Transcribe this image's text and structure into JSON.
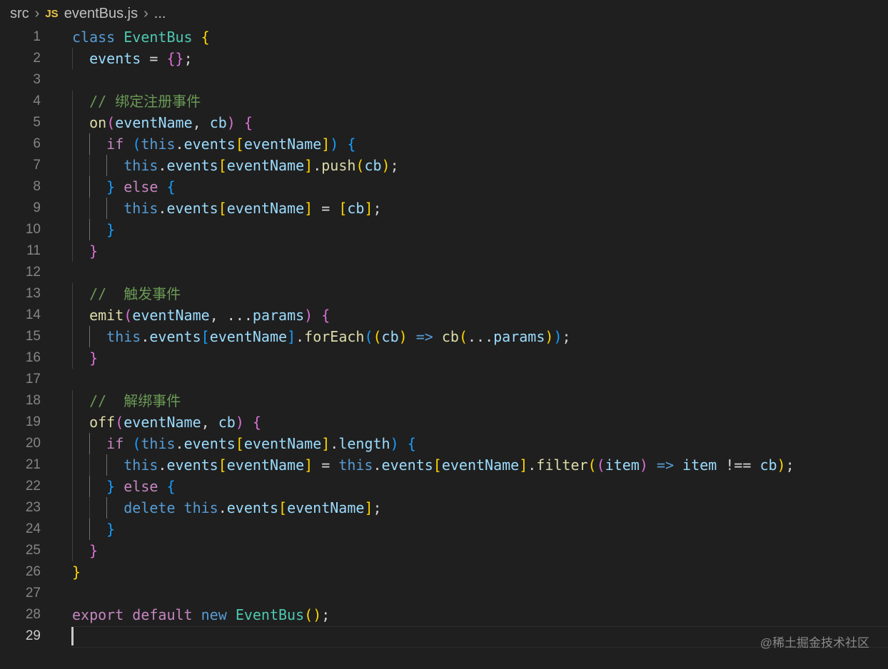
{
  "breadcrumb": {
    "folder": "src",
    "badge": "JS",
    "file": "eventBus.js",
    "more": "...",
    "sep_icon": "chevron-right-icon"
  },
  "colors": {
    "keyword": "#569cd6",
    "control": "#c586c0",
    "class": "#4ec9b0",
    "func": "#dcdcaa",
    "var": "#9cdcfe",
    "comment": "#6a9955",
    "text": "#d4d4d4",
    "brace1": "#ffd700",
    "brace2": "#da70d6",
    "brace3": "#179fff"
  },
  "lines": [
    {
      "n": "1",
      "indent": 0,
      "tokens": [
        [
          "class",
          "keyword"
        ],
        [
          " ",
          ""
        ],
        [
          "EventBus",
          "class"
        ],
        [
          " ",
          ""
        ],
        [
          "{",
          "brace1"
        ]
      ]
    },
    {
      "n": "2",
      "indent": 1,
      "tokens": [
        [
          "events",
          "var"
        ],
        [
          " = ",
          ""
        ],
        [
          "{}",
          "brace2"
        ],
        [
          ";",
          ""
        ]
      ]
    },
    {
      "n": "3",
      "indent": 0,
      "tokens": []
    },
    {
      "n": "4",
      "indent": 1,
      "tokens": [
        [
          "// 绑定注册事件",
          "comment"
        ]
      ]
    },
    {
      "n": "5",
      "indent": 1,
      "tokens": [
        [
          "on",
          "func"
        ],
        [
          "(",
          "brace2"
        ],
        [
          "eventName",
          "var"
        ],
        [
          ", ",
          ""
        ],
        [
          "cb",
          "var"
        ],
        [
          ")",
          "brace2"
        ],
        [
          " ",
          ""
        ],
        [
          "{",
          "brace2"
        ]
      ]
    },
    {
      "n": "6",
      "indent": 2,
      "tokens": [
        [
          "if",
          "control"
        ],
        [
          " ",
          ""
        ],
        [
          "(",
          "brace3"
        ],
        [
          "this",
          "keyword"
        ],
        [
          ".",
          ""
        ],
        [
          "events",
          "var"
        ],
        [
          "[",
          "brace1"
        ],
        [
          "eventName",
          "var"
        ],
        [
          "]",
          "brace1"
        ],
        [
          ")",
          "brace3"
        ],
        [
          " ",
          ""
        ],
        [
          "{",
          "brace3"
        ]
      ]
    },
    {
      "n": "7",
      "indent": 3,
      "tokens": [
        [
          "this",
          "keyword"
        ],
        [
          ".",
          ""
        ],
        [
          "events",
          "var"
        ],
        [
          "[",
          "brace1"
        ],
        [
          "eventName",
          "var"
        ],
        [
          "]",
          "brace1"
        ],
        [
          ".",
          ""
        ],
        [
          "push",
          "func"
        ],
        [
          "(",
          "brace1"
        ],
        [
          "cb",
          "var"
        ],
        [
          ")",
          "brace1"
        ],
        [
          ";",
          ""
        ]
      ]
    },
    {
      "n": "8",
      "indent": 2,
      "tokens": [
        [
          "}",
          "brace3"
        ],
        [
          " ",
          ""
        ],
        [
          "else",
          "control"
        ],
        [
          " ",
          ""
        ],
        [
          "{",
          "brace3"
        ]
      ]
    },
    {
      "n": "9",
      "indent": 3,
      "tokens": [
        [
          "this",
          "keyword"
        ],
        [
          ".",
          ""
        ],
        [
          "events",
          "var"
        ],
        [
          "[",
          "brace1"
        ],
        [
          "eventName",
          "var"
        ],
        [
          "]",
          "brace1"
        ],
        [
          " = ",
          ""
        ],
        [
          "[",
          "brace1"
        ],
        [
          "cb",
          "var"
        ],
        [
          "]",
          "brace1"
        ],
        [
          ";",
          ""
        ]
      ]
    },
    {
      "n": "10",
      "indent": 2,
      "tokens": [
        [
          "}",
          "brace3"
        ]
      ]
    },
    {
      "n": "11",
      "indent": 1,
      "tokens": [
        [
          "}",
          "brace2"
        ]
      ]
    },
    {
      "n": "12",
      "indent": 0,
      "tokens": []
    },
    {
      "n": "13",
      "indent": 1,
      "tokens": [
        [
          "//  触发事件",
          "comment"
        ]
      ]
    },
    {
      "n": "14",
      "indent": 1,
      "tokens": [
        [
          "emit",
          "func"
        ],
        [
          "(",
          "brace2"
        ],
        [
          "eventName",
          "var"
        ],
        [
          ", ",
          ""
        ],
        [
          "...",
          "text"
        ],
        [
          "params",
          "var"
        ],
        [
          ")",
          "brace2"
        ],
        [
          " ",
          ""
        ],
        [
          "{",
          "brace2"
        ]
      ]
    },
    {
      "n": "15",
      "indent": 2,
      "tokens": [
        [
          "this",
          "keyword"
        ],
        [
          ".",
          ""
        ],
        [
          "events",
          "var"
        ],
        [
          "[",
          "brace3"
        ],
        [
          "eventName",
          "var"
        ],
        [
          "]",
          "brace3"
        ],
        [
          ".",
          ""
        ],
        [
          "forEach",
          "func"
        ],
        [
          "(",
          "brace3"
        ],
        [
          "(",
          "brace1"
        ],
        [
          "cb",
          "var"
        ],
        [
          ")",
          "brace1"
        ],
        [
          " ",
          ""
        ],
        [
          "=>",
          "keyword"
        ],
        [
          " ",
          ""
        ],
        [
          "cb",
          "func"
        ],
        [
          "(",
          "brace1"
        ],
        [
          "...",
          "text"
        ],
        [
          "params",
          "var"
        ],
        [
          ")",
          "brace1"
        ],
        [
          ")",
          "brace3"
        ],
        [
          ";",
          ""
        ]
      ]
    },
    {
      "n": "16",
      "indent": 1,
      "tokens": [
        [
          "}",
          "brace2"
        ]
      ]
    },
    {
      "n": "17",
      "indent": 0,
      "tokens": []
    },
    {
      "n": "18",
      "indent": 1,
      "tokens": [
        [
          "//  解绑事件",
          "comment"
        ]
      ]
    },
    {
      "n": "19",
      "indent": 1,
      "tokens": [
        [
          "off",
          "func"
        ],
        [
          "(",
          "brace2"
        ],
        [
          "eventName",
          "var"
        ],
        [
          ", ",
          ""
        ],
        [
          "cb",
          "var"
        ],
        [
          ")",
          "brace2"
        ],
        [
          " ",
          ""
        ],
        [
          "{",
          "brace2"
        ]
      ]
    },
    {
      "n": "20",
      "indent": 2,
      "tokens": [
        [
          "if",
          "control"
        ],
        [
          " ",
          ""
        ],
        [
          "(",
          "brace3"
        ],
        [
          "this",
          "keyword"
        ],
        [
          ".",
          ""
        ],
        [
          "events",
          "var"
        ],
        [
          "[",
          "brace1"
        ],
        [
          "eventName",
          "var"
        ],
        [
          "]",
          "brace1"
        ],
        [
          ".",
          ""
        ],
        [
          "length",
          "var"
        ],
        [
          ")",
          "brace3"
        ],
        [
          " ",
          ""
        ],
        [
          "{",
          "brace3"
        ]
      ]
    },
    {
      "n": "21",
      "indent": 3,
      "tokens": [
        [
          "this",
          "keyword"
        ],
        [
          ".",
          ""
        ],
        [
          "events",
          "var"
        ],
        [
          "[",
          "brace1"
        ],
        [
          "eventName",
          "var"
        ],
        [
          "]",
          "brace1"
        ],
        [
          " = ",
          ""
        ],
        [
          "this",
          "keyword"
        ],
        [
          ".",
          ""
        ],
        [
          "events",
          "var"
        ],
        [
          "[",
          "brace1"
        ],
        [
          "eventName",
          "var"
        ],
        [
          "]",
          "brace1"
        ],
        [
          ".",
          ""
        ],
        [
          "filter",
          "func"
        ],
        [
          "(",
          "brace1"
        ],
        [
          "(",
          "brace2"
        ],
        [
          "item",
          "var"
        ],
        [
          ")",
          "brace2"
        ],
        [
          " ",
          ""
        ],
        [
          "=>",
          "keyword"
        ],
        [
          " ",
          ""
        ],
        [
          "item",
          "var"
        ],
        [
          " !== ",
          ""
        ],
        [
          "cb",
          "var"
        ],
        [
          ")",
          "brace1"
        ],
        [
          ";",
          ""
        ]
      ]
    },
    {
      "n": "22",
      "indent": 2,
      "tokens": [
        [
          "}",
          "brace3"
        ],
        [
          " ",
          ""
        ],
        [
          "else",
          "control"
        ],
        [
          " ",
          ""
        ],
        [
          "{",
          "brace3"
        ]
      ]
    },
    {
      "n": "23",
      "indent": 3,
      "tokens": [
        [
          "delete",
          "keyword"
        ],
        [
          " ",
          ""
        ],
        [
          "this",
          "keyword"
        ],
        [
          ".",
          ""
        ],
        [
          "events",
          "var"
        ],
        [
          "[",
          "brace1"
        ],
        [
          "eventName",
          "var"
        ],
        [
          "]",
          "brace1"
        ],
        [
          ";",
          ""
        ]
      ]
    },
    {
      "n": "24",
      "indent": 2,
      "tokens": [
        [
          "}",
          "brace3"
        ]
      ]
    },
    {
      "n": "25",
      "indent": 1,
      "tokens": [
        [
          "}",
          "brace2"
        ]
      ]
    },
    {
      "n": "26",
      "indent": 0,
      "tokens": [
        [
          "}",
          "brace1"
        ]
      ]
    },
    {
      "n": "27",
      "indent": 0,
      "tokens": []
    },
    {
      "n": "28",
      "indent": 0,
      "tokens": [
        [
          "export",
          "control"
        ],
        [
          " ",
          ""
        ],
        [
          "default",
          "control"
        ],
        [
          " ",
          ""
        ],
        [
          "new",
          "keyword"
        ],
        [
          " ",
          ""
        ],
        [
          "EventBus",
          "class"
        ],
        [
          "(",
          "brace1"
        ],
        [
          ")",
          "brace1"
        ],
        [
          ";",
          ""
        ]
      ]
    },
    {
      "n": "29",
      "indent": 0,
      "tokens": [],
      "current": true
    }
  ],
  "watermark": "@稀土掘金技术社区"
}
